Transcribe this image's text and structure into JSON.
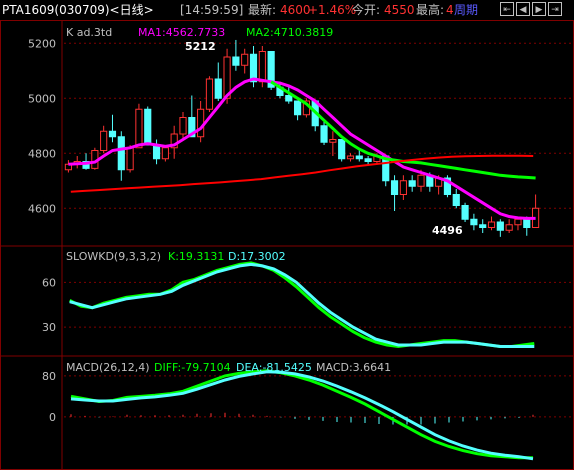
{
  "header": {
    "title": "PTA1609(030709)<日线>",
    "time": "[14:59:59]",
    "latest_label": "最新:",
    "latest_value": "4600",
    "change": "+1.46%",
    "open_label": "今开:",
    "open_value": "4550",
    "high_label": "最高:",
    "high_value": "4",
    "period": "周期",
    "nav_icons": [
      "jump-left-icon",
      "arrow-left-icon",
      "arrow-right-icon",
      "jump-right-icon"
    ]
  },
  "panels": {
    "k": {
      "label": "K  ad.3td",
      "ma1": "MA1:4562.7733",
      "ma2": "MA2:4710.3819",
      "ticks": [
        "5200",
        "5000",
        "4800",
        "4600"
      ],
      "high_label": "5212",
      "low_label": "4496"
    },
    "kd": {
      "label": "SLOWKD(9,3,3,2)",
      "k": "K:19.3131",
      "d": "D:17.3002",
      "ticks": [
        "60",
        "30"
      ]
    },
    "macd": {
      "label": "MACD(26,12,4)",
      "diff": "DIFF:-79.7104",
      "dea": "DEA:-81.5425",
      "macd": "MACD:3.6641",
      "ticks": [
        "80",
        "0"
      ]
    }
  },
  "colors": {
    "up": "#ff3232",
    "down": "#54ffff",
    "ma1": "#ff00ff",
    "ma2": "#00ff00",
    "ma_slow": "#ff0000",
    "grid": "#800000",
    "label": "#c0c0c0"
  },
  "chart_data": [
    {
      "type": "candlestick",
      "title": "PTA1609 daily",
      "ylim": [
        4470,
        5270
      ],
      "candles": [
        [
          4740,
          4775,
          4730,
          4760
        ],
        [
          4760,
          4790,
          4745,
          4770
        ],
        [
          4770,
          4800,
          4740,
          4745
        ],
        [
          4745,
          4820,
          4740,
          4810
        ],
        [
          4810,
          4900,
          4800,
          4880
        ],
        [
          4880,
          4940,
          4840,
          4860
        ],
        [
          4860,
          4880,
          4700,
          4740
        ],
        [
          4740,
          4830,
          4730,
          4820
        ],
        [
          4820,
          4980,
          4820,
          4960
        ],
        [
          4960,
          4970,
          4860,
          4830
        ],
        [
          4830,
          4850,
          4760,
          4780
        ],
        [
          4780,
          4830,
          4770,
          4820
        ],
        [
          4820,
          4900,
          4780,
          4870
        ],
        [
          4870,
          4950,
          4850,
          4930
        ],
        [
          4930,
          5010,
          4880,
          4860
        ],
        [
          4860,
          4990,
          4840,
          4960
        ],
        [
          4960,
          5080,
          4950,
          5070
        ],
        [
          5070,
          5130,
          4990,
          5000
        ],
        [
          5000,
          5180,
          4980,
          5150
        ],
        [
          5150,
          5212,
          5100,
          5120
        ],
        [
          5120,
          5180,
          5090,
          5160
        ],
        [
          5160,
          5190,
          5040,
          5060
        ],
        [
          5060,
          5190,
          5040,
          5170
        ],
        [
          5170,
          5120,
          5030,
          5040
        ],
        [
          5040,
          5060,
          5000,
          5010
        ],
        [
          5010,
          5040,
          4980,
          4990
        ],
        [
          4990,
          4980,
          4920,
          4940
        ],
        [
          4940,
          5000,
          4930,
          4990
        ],
        [
          4990,
          4960,
          4880,
          4900
        ],
        [
          4900,
          4920,
          4830,
          4840
        ],
        [
          4840,
          4880,
          4790,
          4850
        ],
        [
          4850,
          4840,
          4770,
          4780
        ],
        [
          4780,
          4800,
          4770,
          4790
        ],
        [
          4790,
          4810,
          4770,
          4780
        ],
        [
          4780,
          4790,
          4760,
          4770
        ],
        [
          4770,
          4800,
          4760,
          4790
        ],
        [
          4790,
          4750,
          4680,
          4700
        ],
        [
          4700,
          4720,
          4590,
          4650
        ],
        [
          4650,
          4720,
          4630,
          4700
        ],
        [
          4700,
          4720,
          4660,
          4680
        ],
        [
          4680,
          4740,
          4660,
          4720
        ],
        [
          4720,
          4730,
          4660,
          4680
        ],
        [
          4680,
          4720,
          4650,
          4710
        ],
        [
          4710,
          4720,
          4640,
          4650
        ],
        [
          4650,
          4670,
          4600,
          4610
        ],
        [
          4610,
          4620,
          4550,
          4560
        ],
        [
          4560,
          4580,
          4520,
          4540
        ],
        [
          4540,
          4560,
          4510,
          4530
        ],
        [
          4530,
          4570,
          4520,
          4550
        ],
        [
          4550,
          4560,
          4496,
          4520
        ],
        [
          4520,
          4560,
          4510,
          4540
        ],
        [
          4540,
          4570,
          4520,
          4560
        ],
        [
          4560,
          4570,
          4500,
          4530
        ],
        [
          4530,
          4650,
          4530,
          4600
        ]
      ],
      "series": [
        {
          "name": "MA1",
          "values": [
            4760,
            4762,
            4764,
            4768,
            4790,
            4810,
            4815,
            4820,
            4830,
            4835,
            4830,
            4825,
            4830,
            4850,
            4870,
            4890,
            4930,
            4970,
            5010,
            5040,
            5060,
            5070,
            5065,
            5060,
            5055,
            5045,
            5030,
            5010,
            4990,
            4960,
            4930,
            4900,
            4870,
            4850,
            4830,
            4810,
            4790,
            4770,
            4750,
            4740,
            4730,
            4720,
            4710,
            4700,
            4680,
            4660,
            4640,
            4620,
            4600,
            4580,
            4570,
            4565,
            4563,
            4563
          ]
        },
        {
          "name": "MA2",
          "values": [
            null,
            null,
            null,
            null,
            null,
            null,
            null,
            null,
            null,
            null,
            null,
            null,
            null,
            null,
            null,
            null,
            null,
            null,
            null,
            null,
            null,
            null,
            null,
            5060,
            5040,
            5020,
            5000,
            4980,
            4950,
            4920,
            4890,
            4860,
            4835,
            4815,
            4800,
            4790,
            4780,
            4775,
            4770,
            4768,
            4765,
            4760,
            4755,
            4750,
            4745,
            4740,
            4735,
            4730,
            4725,
            4720,
            4717,
            4714,
            4712,
            4710
          ]
        },
        {
          "name": "MA3",
          "values": [
            4660,
            4663,
            4666,
            4669,
            4672,
            4675,
            4678,
            4681,
            4684,
            4688,
            4691,
            4694,
            4698,
            4702,
            4706,
            4712,
            4718,
            4724,
            4730,
            4738,
            4745,
            4752,
            4758,
            4764,
            4770,
            4775,
            4780,
            4784,
            4787,
            4789,
            4790,
            4791,
            4791,
            4791,
            4790
          ]
        }
      ]
    },
    {
      "type": "line",
      "title": "SLOWKD(9,3,3,2)",
      "ylim": [
        12,
        83
      ],
      "series": [
        {
          "name": "K",
          "values": [
            48,
            44,
            43,
            46,
            48,
            50,
            51,
            52,
            52,
            55,
            60,
            62,
            65,
            68,
            70,
            72,
            73,
            71,
            68,
            63,
            57,
            50,
            43,
            37,
            32,
            27,
            23,
            20,
            18,
            17,
            18,
            19,
            20,
            21,
            21,
            20,
            19,
            18,
            17,
            17,
            18,
            19
          ]
        },
        {
          "name": "D",
          "values": [
            47,
            45,
            43,
            45,
            47,
            49,
            50,
            51,
            52,
            54,
            58,
            61,
            64,
            67,
            69,
            71,
            72,
            71,
            69,
            65,
            60,
            53,
            46,
            40,
            35,
            30,
            26,
            22,
            20,
            18,
            18,
            18,
            19,
            20,
            20,
            20,
            19,
            18,
            17,
            17,
            17,
            17
          ]
        }
      ]
    },
    {
      "type": "line",
      "title": "MACD(26,12,4)",
      "ylim": [
        -100,
        115
      ],
      "series": [
        {
          "name": "DIFF",
          "values": [
            40,
            35,
            30,
            32,
            38,
            40,
            42,
            45,
            50,
            60,
            70,
            80,
            85,
            88,
            90,
            86,
            80,
            72,
            62,
            50,
            38,
            25,
            10,
            -5,
            -20,
            -35,
            -48,
            -58,
            -66,
            -72,
            -76,
            -78,
            -80,
            -80
          ]
        },
        {
          "name": "DEA",
          "values": [
            35,
            33,
            31,
            31,
            34,
            37,
            39,
            42,
            46,
            54,
            63,
            72,
            79,
            84,
            88,
            87,
            84,
            78,
            70,
            60,
            49,
            37,
            24,
            10,
            -5,
            -20,
            -35,
            -47,
            -57,
            -65,
            -71,
            -75,
            -78,
            -82
          ]
        },
        {
          "name": "MACD",
          "values": [
            5,
            2,
            -1,
            1,
            4,
            3,
            3,
            3,
            4,
            6,
            7,
            8,
            6,
            4,
            2,
            -1,
            -4,
            -6,
            -8,
            -10,
            -11,
            -12,
            -14,
            -15,
            -15,
            -15,
            -13,
            -11,
            -9,
            -7,
            -5,
            -3,
            -2,
            4
          ]
        }
      ]
    }
  ]
}
